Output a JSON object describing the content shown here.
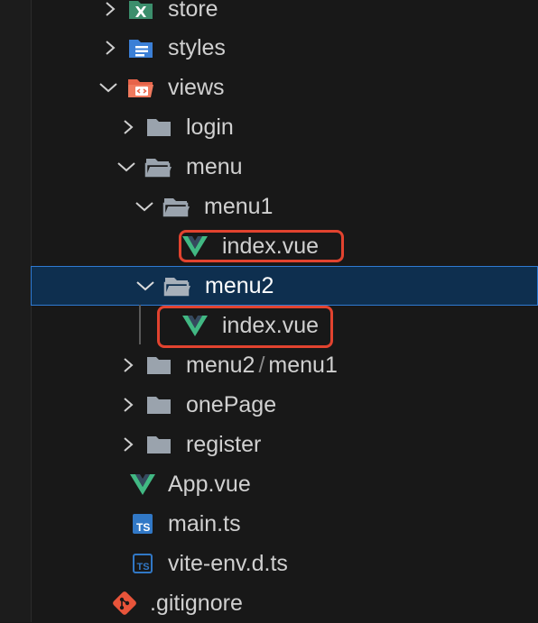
{
  "explorer": {
    "items": [
      {
        "label": "store",
        "type": "folder-store"
      },
      {
        "label": "styles",
        "type": "folder-styles"
      },
      {
        "label": "views",
        "type": "folder-views"
      },
      {
        "label": "login",
        "type": "folder"
      },
      {
        "label": "menu",
        "type": "folder-open"
      },
      {
        "label": "menu1",
        "type": "folder-open"
      },
      {
        "label": "index.vue",
        "type": "vue-file"
      },
      {
        "label": "menu2",
        "type": "folder-open",
        "selected": true
      },
      {
        "label": "index.vue",
        "type": "vue-file"
      },
      {
        "label_a": "menu2",
        "label_b": "menu1",
        "separator": "/",
        "type": "folder"
      },
      {
        "label": "onePage",
        "type": "folder"
      },
      {
        "label": "register",
        "type": "folder"
      },
      {
        "label": "App.vue",
        "type": "vue-file"
      },
      {
        "label": "main.ts",
        "type": "ts-file"
      },
      {
        "label": "vite-env.d.ts",
        "type": "ts-file"
      },
      {
        "label": ".gitignore",
        "type": "git-file"
      }
    ]
  },
  "colors": {
    "background": "#181818",
    "selection": "#0e2f4f",
    "selection_border": "#2f7ad2",
    "highlight_box": "#e2432f",
    "vue_green": "#41b883",
    "vue_dark": "#35495e",
    "ts_blue": "#3178c6",
    "git_orange": "#e8543a",
    "folder_gray": "#9aa3ad"
  }
}
